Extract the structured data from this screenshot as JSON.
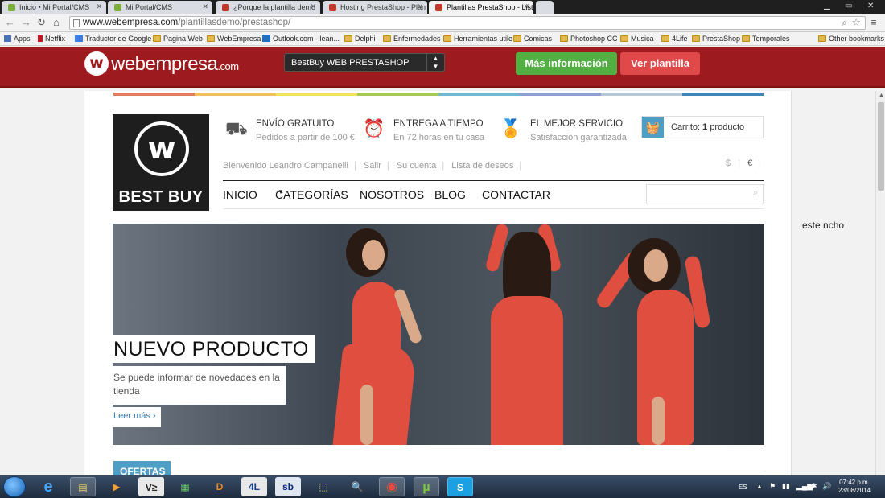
{
  "browser": {
    "tabs": [
      {
        "label": "Inicio • Mi Portal/CMS",
        "active": false,
        "favicon_color": "#7cae3c"
      },
      {
        "label": "Mi Portal/CMS",
        "active": false,
        "favicon_color": "#7cae3c"
      },
      {
        "label": "¿Porque la plantilla demo",
        "active": false,
        "favicon_color": "#c0392b"
      },
      {
        "label": "Hosting PrestaShop - Plan",
        "active": false,
        "favicon_color": "#c0392b"
      },
      {
        "label": "Plantillas PrestaShop - List",
        "active": true,
        "favicon_color": "#c0392b"
      }
    ],
    "url_host": "www.webempresa.com",
    "url_path": "/plantillasdemo/prestashop/",
    "bookmarks": [
      {
        "label": "Apps",
        "icon": "apps-grid-icon"
      },
      {
        "label": "Netflix",
        "icon": "netflix-icon"
      },
      {
        "label": "Traductor de Google",
        "icon": "translate-icon"
      },
      {
        "label": "Pagina Web",
        "icon": "folder-icon"
      },
      {
        "label": "WebEmpresa",
        "icon": "folder-icon"
      },
      {
        "label": "Outlook.com - lean...",
        "icon": "outlook-icon"
      },
      {
        "label": "Delphi",
        "icon": "folder-icon"
      },
      {
        "label": "Enfermedades",
        "icon": "folder-icon"
      },
      {
        "label": "Herramientas utile",
        "icon": "folder-icon"
      },
      {
        "label": "Comicas",
        "icon": "folder-icon"
      },
      {
        "label": "Photoshop CC",
        "icon": "folder-icon"
      },
      {
        "label": "Musica",
        "icon": "folder-icon"
      },
      {
        "label": "4Life",
        "icon": "folder-icon"
      },
      {
        "label": "PrestaShop",
        "icon": "folder-icon"
      },
      {
        "label": "Temporales",
        "icon": "folder-icon"
      },
      {
        "label": "Other bookmarks",
        "icon": "folder-icon"
      }
    ]
  },
  "webbar": {
    "logo_text": "webempresa",
    "logo_suffix": ".com",
    "template_select": "BestBuy WEB PRESTASHOP",
    "info_button": "Más información",
    "view_button": "Ver plantilla"
  },
  "store": {
    "logo_name": "BEST BUY",
    "features": [
      {
        "title": "ENVÍO GRATUITO",
        "subtitle": "Pedidos a partir de 100 €",
        "icon": "truck-icon"
      },
      {
        "title": "ENTREGA A TIEMPO",
        "subtitle": "En 72 horas en tu casa",
        "icon": "alarm-clock-icon"
      },
      {
        "title": "EL MEJOR SERVICIO",
        "subtitle": "Satisfacción garantizada",
        "icon": "award-ribbon-icon"
      }
    ],
    "cart": {
      "label": "Carrito:",
      "count": "1",
      "unit": "producto"
    },
    "user_links": [
      "Bienvenido Leandro Campanelli",
      "Salir",
      "Su cuenta",
      "Lista de deseos"
    ],
    "currencies": [
      "$",
      "€"
    ],
    "nav": [
      "INICIO",
      "CATEGORÍAS",
      "NOSOTROS",
      "BLOG",
      "CONTACTAR"
    ],
    "hero": {
      "title": "NUEVO PRODUCTO",
      "description": "Se puede informar de novedades en la tienda",
      "link": "Leer más ›"
    },
    "section_tab": "OFERTAS",
    "accent_color": "#4d9fc5",
    "stripe_colors": [
      "#e27d60",
      "#f0c05a",
      "#f2e35c",
      "#a7c957",
      "#6fb8d0",
      "#8f9fd6",
      "#b7c7d6",
      "#3e85b9"
    ]
  },
  "side_note": "este ncho",
  "taskbar": {
    "apps": [
      "internet-explorer-icon",
      "file-explorer-icon",
      "media-player-icon",
      "visual-studio-icon",
      "calculator-icon",
      "delphi-icon",
      "4life-icon",
      "sb-icon",
      "folder-icon",
      "magnifier-icon",
      "chrome-icon",
      "utorrent-icon",
      "skype-icon"
    ],
    "app_labels": [
      "e",
      "▤",
      "▶",
      "V≥",
      "▦",
      "D",
      "4L",
      "sb",
      "⬚",
      "🔍",
      "◉",
      "µ",
      "S"
    ],
    "language": "ES",
    "time": "07:42 p.m.",
    "date": "23/08/2014"
  }
}
